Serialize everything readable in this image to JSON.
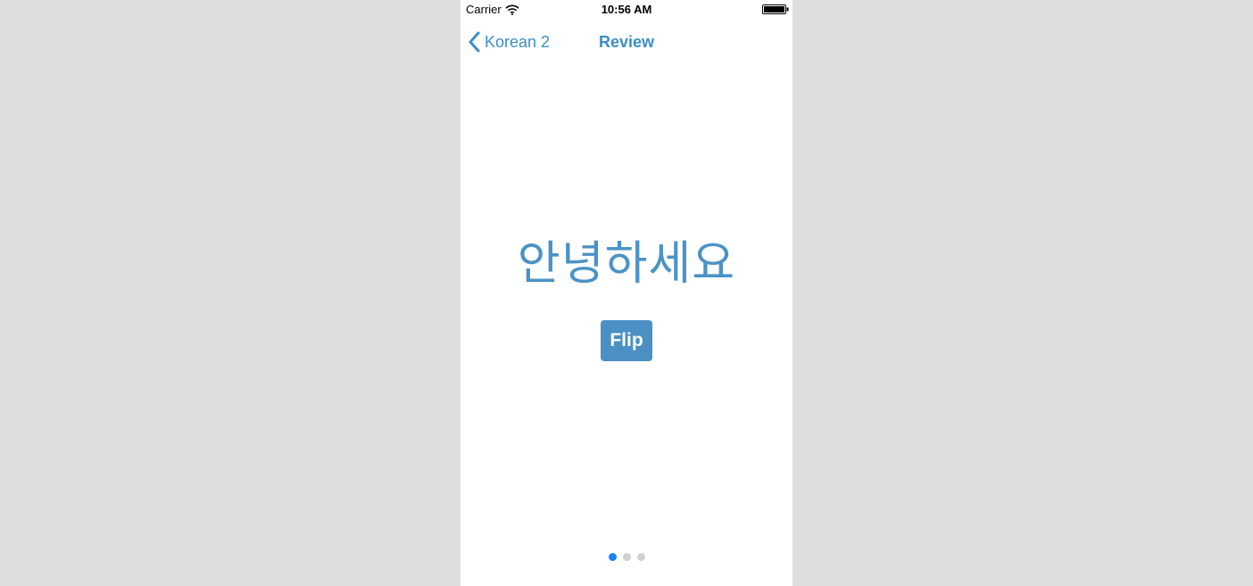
{
  "status_bar": {
    "carrier": "Carrier",
    "time": "10:56 AM",
    "wifi_icon": "wifi-icon",
    "battery_icon": "battery-icon"
  },
  "nav": {
    "back_label": "Korean 2",
    "back_icon": "chevron-left-icon",
    "title": "Review"
  },
  "card": {
    "word": "안녕하세요",
    "flip_label": "Flip"
  },
  "page_control": {
    "count": 3,
    "current": 0,
    "active_color": "#1a82f7",
    "inactive_color": "#cfcfd4"
  },
  "colors": {
    "accent": "#3b8fc6",
    "button_bg": "#4a90c4",
    "background": "#dedede"
  }
}
